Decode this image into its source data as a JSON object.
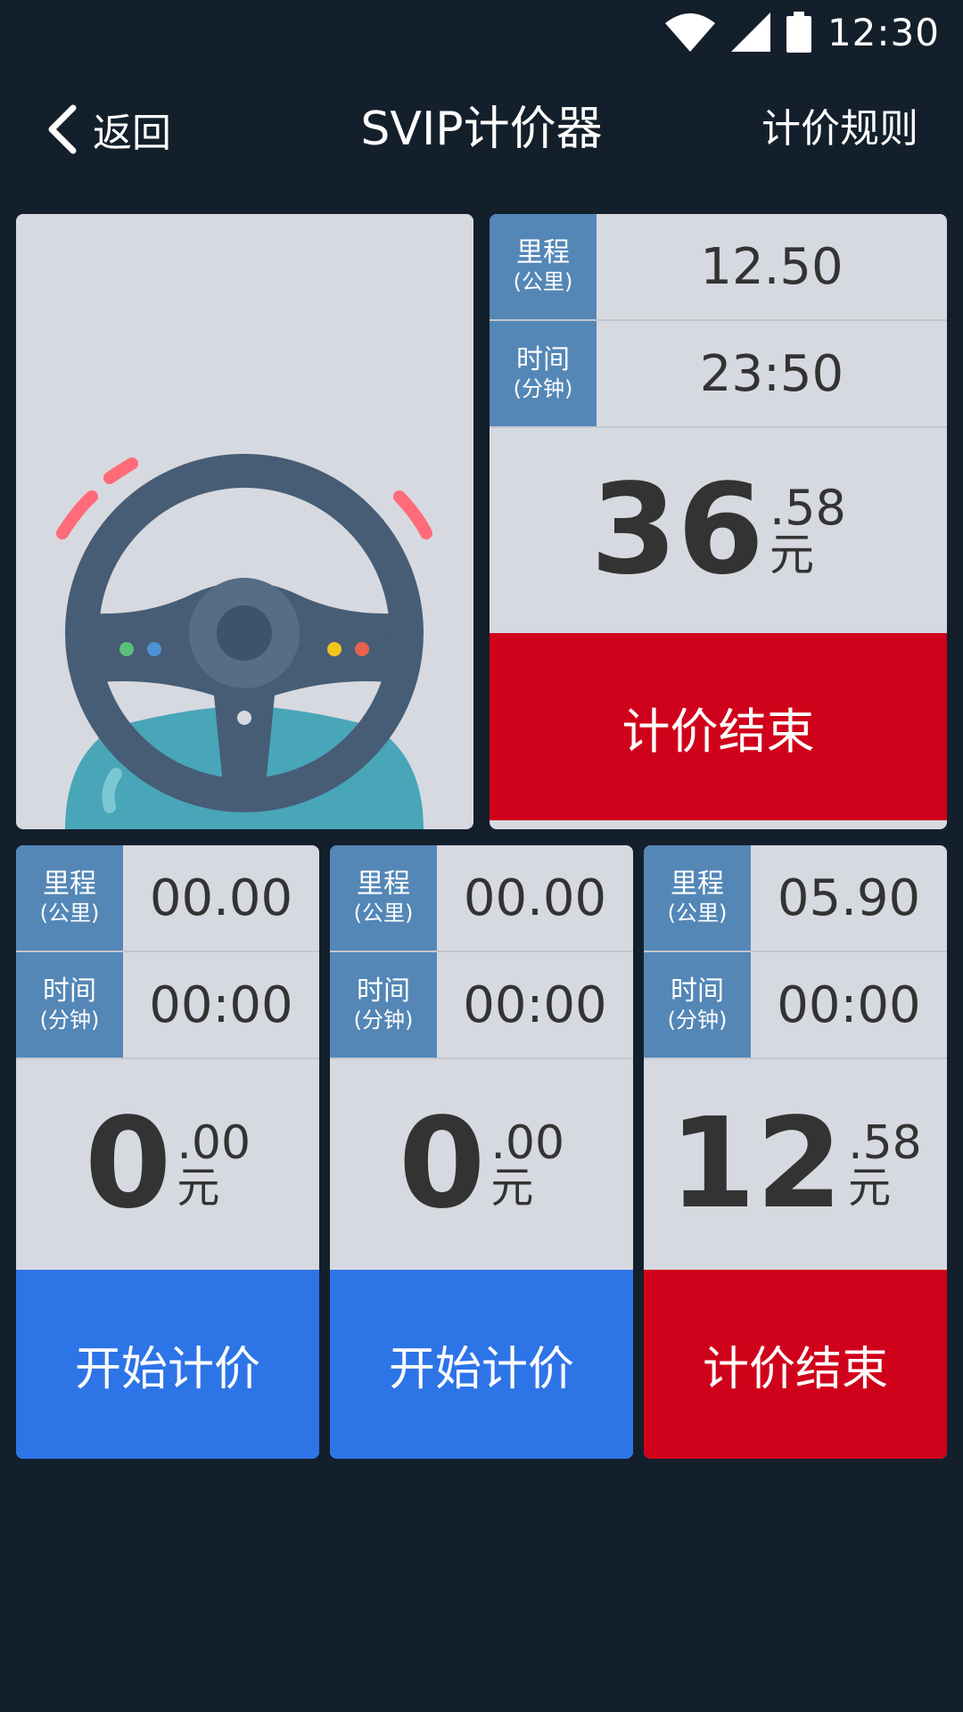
{
  "status_bar": {
    "time": "12:30",
    "icons": [
      "wifi-icon",
      "cellular-signal-icon",
      "battery-icon"
    ]
  },
  "header": {
    "back_label": "返回",
    "title": "SVIP计价器",
    "rules_label": "计价规则"
  },
  "colors": {
    "background": "#141f2c",
    "card": "#d7d9e0",
    "label_blue": "#5487b6",
    "end_red": "#d0021b",
    "start_blue": "#2d74e7",
    "wheel": "#465d75",
    "seat": "#48a6b8"
  },
  "labels": {
    "distance": "里程",
    "distance_unit": "(公里)",
    "time": "时间",
    "time_unit": "(分钟)",
    "currency": "元"
  },
  "main_meter": {
    "distance": "12.50",
    "time": "23:50",
    "price_integer": "36",
    "price_decimal": ".58",
    "button_label": "计价结束"
  },
  "meters": [
    {
      "distance": "00.00",
      "time": "00:00",
      "price_integer": "0",
      "price_decimal": ".00",
      "button_label": "开始计价"
    },
    {
      "distance": "00.00",
      "time": "00:00",
      "price_integer": "0",
      "price_decimal": ".00",
      "button_label": "开始计价"
    },
    {
      "distance": "05.90",
      "time": "00:00",
      "price_integer": "12",
      "price_decimal": ".58",
      "button_label": "计价结束"
    }
  ]
}
